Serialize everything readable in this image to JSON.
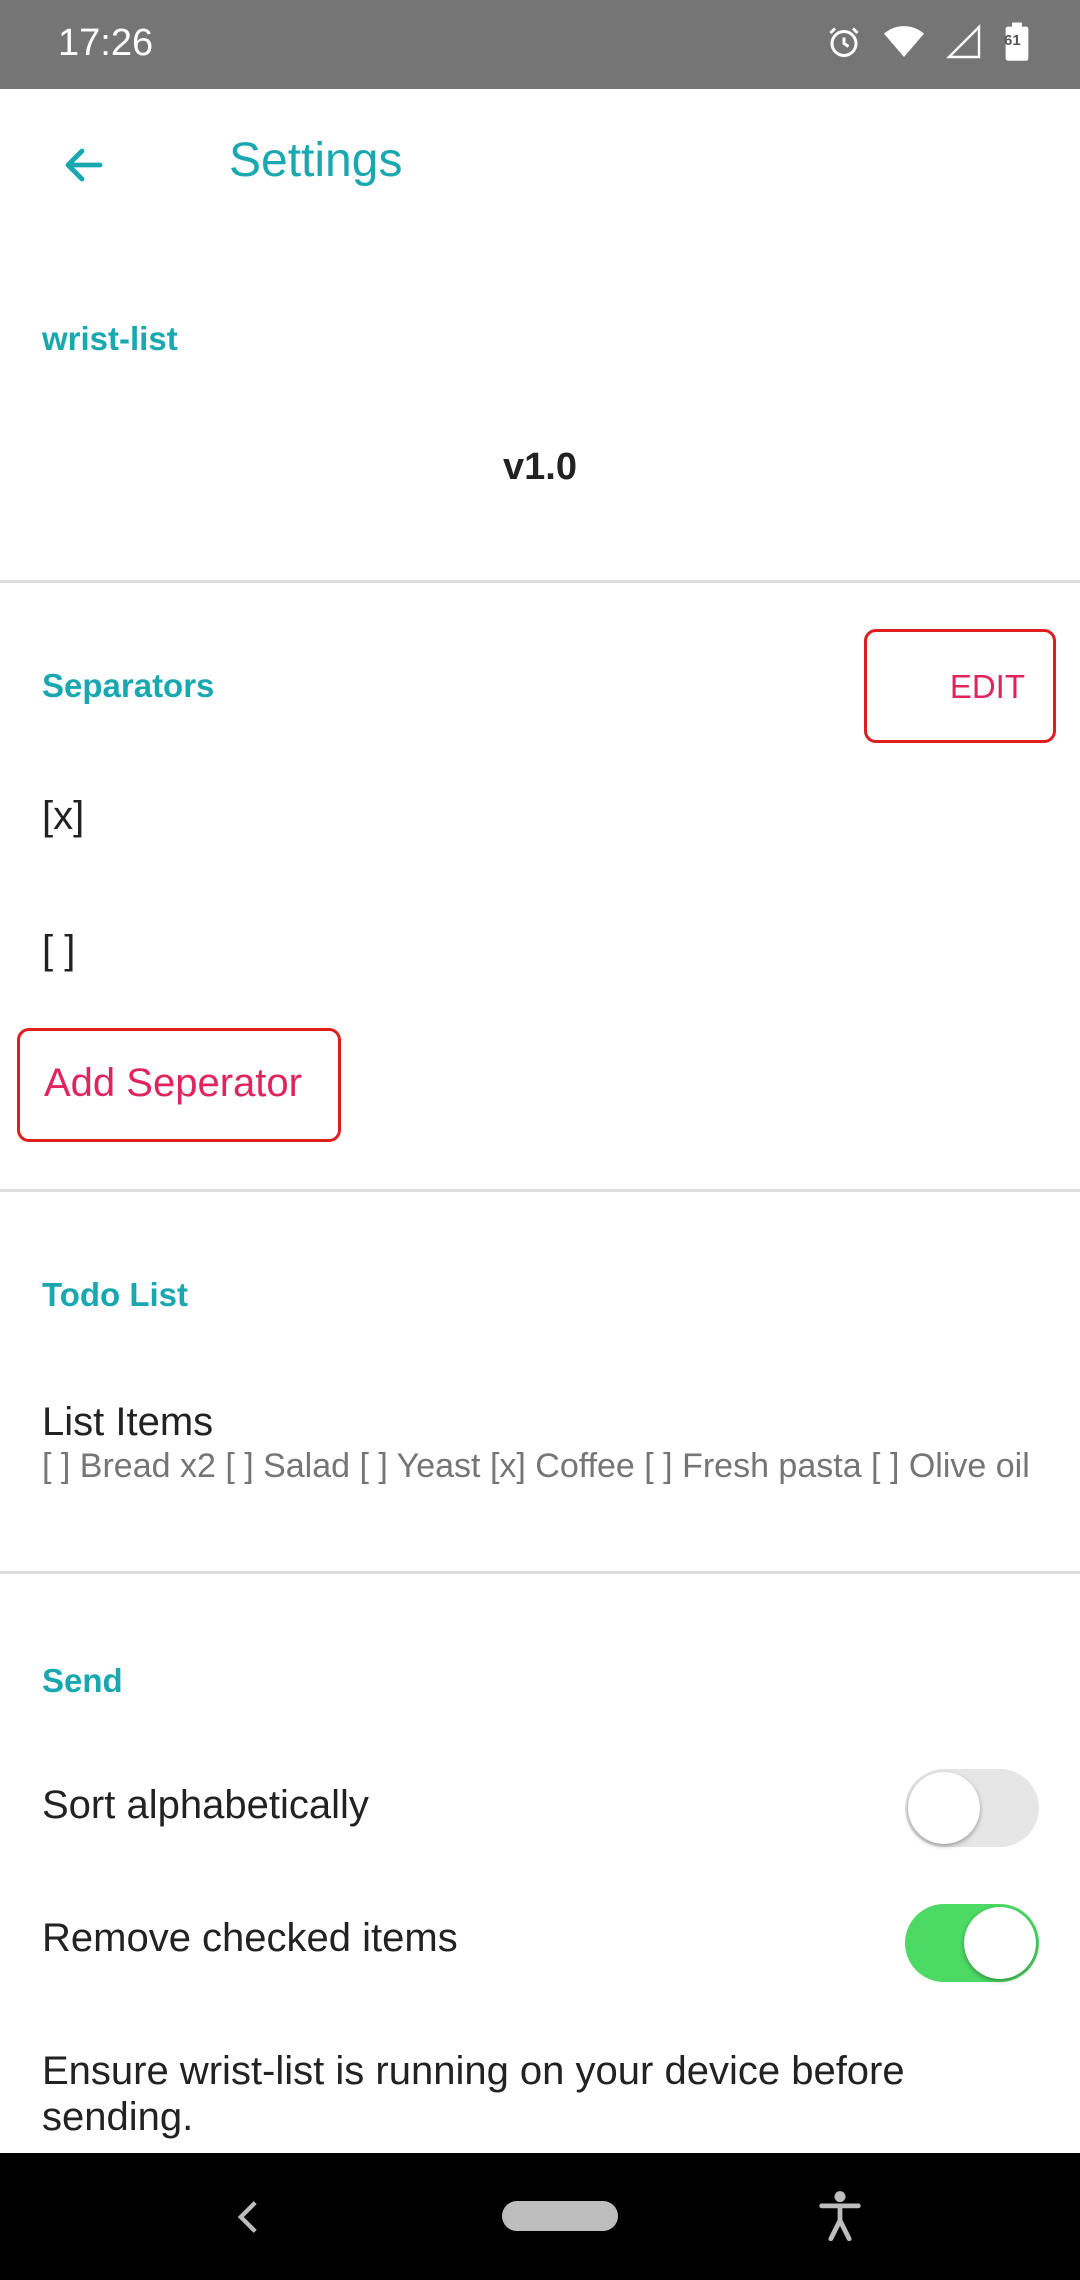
{
  "status_bar": {
    "time": "17:26",
    "icons": [
      "alarm-icon",
      "wifi-icon",
      "signal-icon",
      "battery-icon"
    ],
    "battery_level": "61"
  },
  "app_bar": {
    "title": "Settings",
    "back_icon": "arrow-back-icon"
  },
  "sections": {
    "app": {
      "header": "wrist-list",
      "version": "v1.0"
    },
    "separators": {
      "header": "Separators",
      "edit_label": "EDIT",
      "items": [
        "[x]",
        "[ ]"
      ],
      "add_label": "Add Seperator"
    },
    "todo": {
      "header": "Todo List",
      "list_items_title": "List Items",
      "list_items_value": "[ ] Bread x2 [ ] Salad [ ] Yeast [x] Coffee [ ] Fresh pasta [ ] Olive oil"
    },
    "send": {
      "header": "Send",
      "sort_label": "Sort alphabetically",
      "sort_on": false,
      "remove_label": "Remove checked items",
      "remove_on": true,
      "note": "Ensure wrist-list is running on your device before sending."
    }
  },
  "colors": {
    "accent": "#1aa8b0",
    "action": "#e0245e",
    "toggle_on": "#4cd964",
    "toggle_off": "#e6e6e6",
    "status_bar": "#757575"
  },
  "nav_bar": {
    "icons": [
      "nav-back-icon",
      "nav-home-pill",
      "accessibility-icon"
    ]
  }
}
